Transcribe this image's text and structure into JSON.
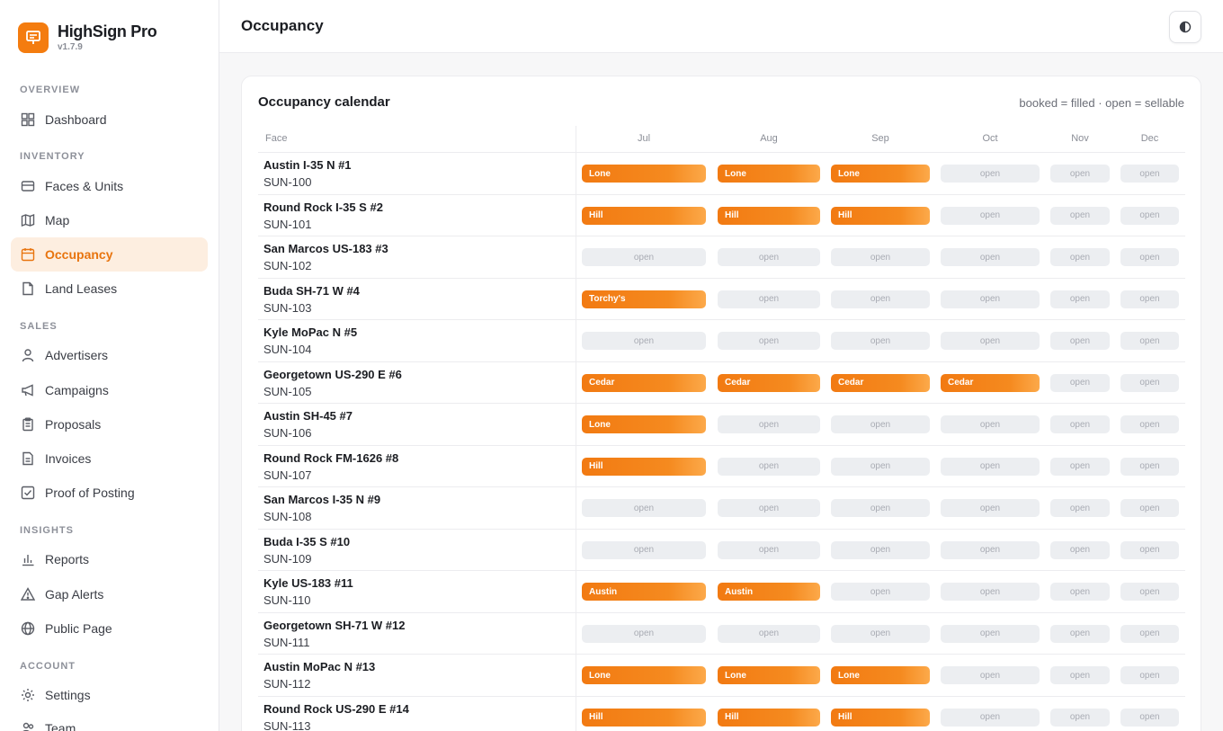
{
  "brand": {
    "name": "HighSign Pro",
    "version": "v1.7.9"
  },
  "nav": {
    "sections": [
      "OVERVIEW",
      "INVENTORY",
      "SALES",
      "INSIGHTS",
      "ACCOUNT"
    ],
    "items": [
      {
        "label": "Dashboard",
        "icon": "dashboard-icon"
      },
      {
        "label": "Faces & Units",
        "icon": "faces-icon"
      },
      {
        "label": "Map",
        "icon": "map-icon"
      },
      {
        "label": "Occupancy",
        "icon": "calendar-icon"
      },
      {
        "label": "Land Leases",
        "icon": "document-icon"
      },
      {
        "label": "Advertisers",
        "icon": "user-icon"
      },
      {
        "label": "Campaigns",
        "icon": "megaphone-icon"
      },
      {
        "label": "Proposals",
        "icon": "clipboard-icon"
      },
      {
        "label": "Invoices",
        "icon": "invoice-icon"
      },
      {
        "label": "Proof of Posting",
        "icon": "check-square-icon"
      },
      {
        "label": "Reports",
        "icon": "bar-chart-icon"
      },
      {
        "label": "Gap Alerts",
        "icon": "alert-icon"
      },
      {
        "label": "Public Page",
        "icon": "globe-icon"
      },
      {
        "label": "Settings",
        "icon": "gear-icon"
      },
      {
        "label": "Team",
        "icon": "team-icon"
      }
    ]
  },
  "header": {
    "title": "Occupancy"
  },
  "calendar": {
    "title": "Occupancy calendar",
    "legend": "booked = filled · open = sellable",
    "face_header": "Face",
    "months": [
      "Jul",
      "Aug",
      "Sep",
      "Oct",
      "Nov",
      "Dec"
    ],
    "open_label": "open",
    "accent": "#f47c0f",
    "rows": [
      {
        "name": "Austin I-35 N #1",
        "code": "SUN-100",
        "cells": [
          "Lone",
          "Lone",
          "Lone",
          "",
          "",
          ""
        ]
      },
      {
        "name": "Round Rock I-35 S #2",
        "code": "SUN-101",
        "cells": [
          "Hill",
          "Hill",
          "Hill",
          "",
          "",
          ""
        ]
      },
      {
        "name": "San Marcos US-183 #3",
        "code": "SUN-102",
        "cells": [
          "",
          "",
          "",
          "",
          "",
          ""
        ]
      },
      {
        "name": "Buda SH-71 W #4",
        "code": "SUN-103",
        "cells": [
          "Torchy's",
          "",
          "",
          "",
          "",
          ""
        ]
      },
      {
        "name": "Kyle MoPac N #5",
        "code": "SUN-104",
        "cells": [
          "",
          "",
          "",
          "",
          "",
          ""
        ]
      },
      {
        "name": "Georgetown US-290 E #6",
        "code": "SUN-105",
        "cells": [
          "Cedar",
          "Cedar",
          "Cedar",
          "Cedar",
          "",
          ""
        ]
      },
      {
        "name": "Austin SH-45 #7",
        "code": "SUN-106",
        "cells": [
          "Lone",
          "",
          "",
          "",
          "",
          ""
        ]
      },
      {
        "name": "Round Rock FM-1626 #8",
        "code": "SUN-107",
        "cells": [
          "Hill",
          "",
          "",
          "",
          "",
          ""
        ]
      },
      {
        "name": "San Marcos I-35 N #9",
        "code": "SUN-108",
        "cells": [
          "",
          "",
          "",
          "",
          "",
          ""
        ]
      },
      {
        "name": "Buda I-35 S #10",
        "code": "SUN-109",
        "cells": [
          "",
          "",
          "",
          "",
          "",
          ""
        ]
      },
      {
        "name": "Kyle US-183 #11",
        "code": "SUN-110",
        "cells": [
          "Austin",
          "Austin",
          "",
          "",
          "",
          ""
        ]
      },
      {
        "name": "Georgetown SH-71 W #12",
        "code": "SUN-111",
        "cells": [
          "",
          "",
          "",
          "",
          "",
          ""
        ]
      },
      {
        "name": "Austin MoPac N #13",
        "code": "SUN-112",
        "cells": [
          "Lone",
          "Lone",
          "Lone",
          "",
          "",
          ""
        ]
      },
      {
        "name": "Round Rock US-290 E #14",
        "code": "SUN-113",
        "cells": [
          "Hill",
          "Hill",
          "Hill",
          "",
          "",
          ""
        ]
      }
    ]
  }
}
